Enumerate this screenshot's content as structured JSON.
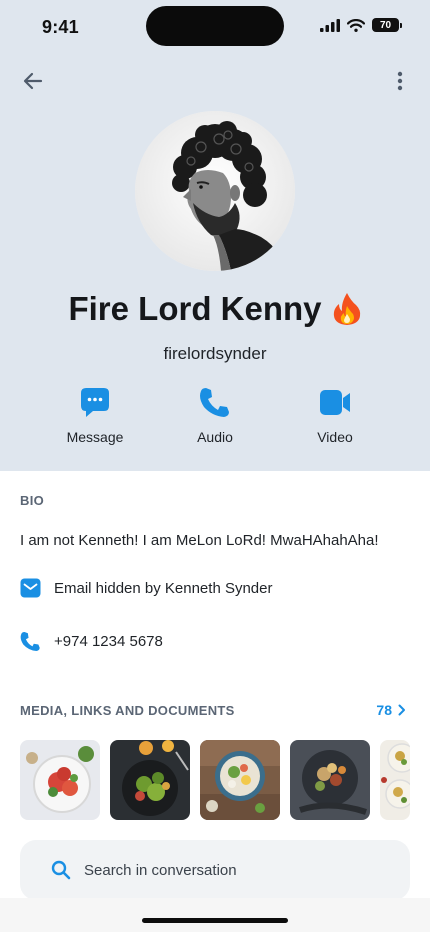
{
  "status_bar": {
    "time": "9:41",
    "battery": "70"
  },
  "profile": {
    "name": "Fire Lord Kenny",
    "emoji": "🔥",
    "username": "firelordsynder"
  },
  "actions": [
    {
      "label": "Message",
      "icon": "chat-bubble-icon"
    },
    {
      "label": "Audio",
      "icon": "phone-icon"
    },
    {
      "label": "Video",
      "icon": "video-camera-icon"
    }
  ],
  "bio": {
    "title": "BIO",
    "text": "I am not Kenneth! I am MeLon LoRd! MwaHAhahAha!",
    "email": "Email hidden by Kenneth Synder",
    "phone": "+974 1234 5678"
  },
  "media": {
    "title": "MEDIA, LINKS AND DOCUMENTS",
    "count": "78"
  },
  "search": {
    "placeholder": "Search in conversation"
  },
  "colors": {
    "accent": "#1a8fe3",
    "header_bg": "#dfe6ee"
  }
}
